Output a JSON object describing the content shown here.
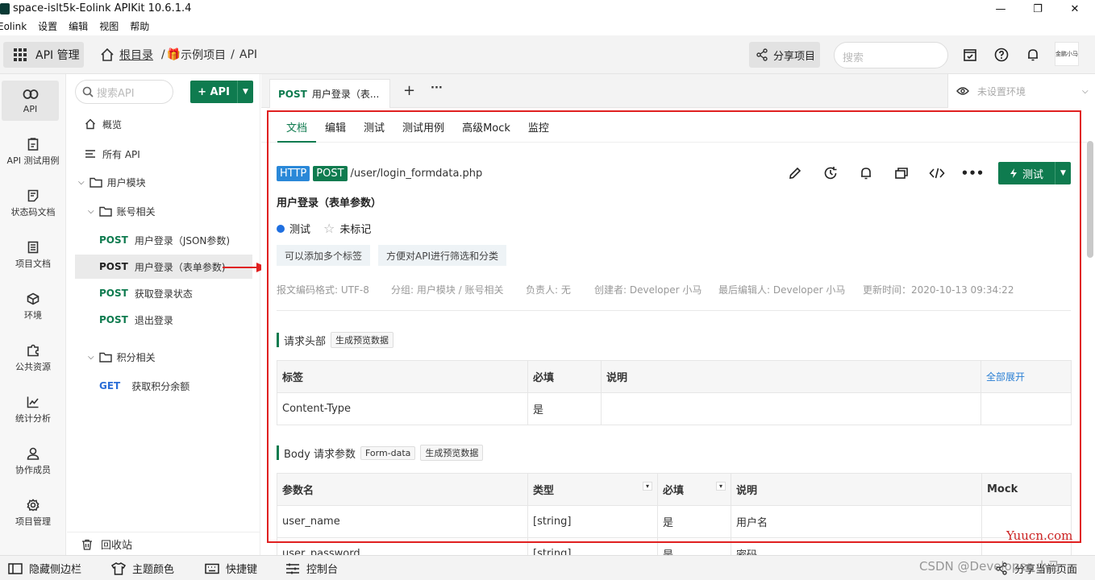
{
  "window": {
    "title": "space-islt5k-Eolink APIKit 10.6.1.4",
    "min": "—",
    "max": "❐",
    "close": "✕"
  },
  "menu": [
    "Eolink",
    "设置",
    "编辑",
    "视图",
    "帮助"
  ],
  "header": {
    "app_switch": "API 管理",
    "breadcrumb_root": "根目录",
    "breadcrumb_sep1": "/",
    "breadcrumb_project": "示例项目",
    "breadcrumb_sep2": "/",
    "breadcrumb_api": "API",
    "share_button": "分享项目",
    "search_placeholder": "搜索",
    "avatar_text": "金鹏小马"
  },
  "rail": [
    {
      "label": "API",
      "icon": "link-icon",
      "active": true
    },
    {
      "label": "API 测试用例",
      "icon": "clipboard-icon"
    },
    {
      "label": "状态码文档",
      "icon": "doc-icon"
    },
    {
      "label": "项目文档",
      "icon": "file-icon"
    },
    {
      "label": "环境",
      "icon": "cube-icon"
    },
    {
      "label": "公共资源",
      "icon": "puzzle-icon"
    },
    {
      "label": "统计分析",
      "icon": "chart-icon"
    },
    {
      "label": "协作成员",
      "icon": "user-icon"
    },
    {
      "label": "项目管理",
      "icon": "gear-icon"
    }
  ],
  "tree": {
    "search_placeholder": "搜索API",
    "add_button": "+ API",
    "overview": "概览",
    "all_api": "所有 API",
    "group_user": "用户模块",
    "group_account": "账号相关",
    "apis_account": [
      {
        "method": "POST",
        "name": "用户登录（JSON参数)"
      },
      {
        "method": "POST",
        "name": "用户登录（表单参数)"
      },
      {
        "method": "POST",
        "name": "获取登录状态"
      },
      {
        "method": "POST",
        "name": "退出登录"
      }
    ],
    "group_points": "积分相关",
    "apis_points": [
      {
        "method": "GET",
        "name": "获取积分余额"
      }
    ],
    "recycle": "回收站"
  },
  "tabs": {
    "active_method": "POST",
    "active_label": "用户登录（表...",
    "add": "+",
    "more": "···",
    "env": "未设置环境"
  },
  "doc": {
    "subtabs": [
      "文档",
      "编辑",
      "测试",
      "测试用例",
      "高级Mock",
      "监控"
    ],
    "protocol": "HTTP",
    "method": "POST",
    "path": "/user/login_formdata.php",
    "title": "用户登录（表单参数）",
    "status": "测试",
    "star_label": "未标记",
    "tags": [
      "可以添加多个标签",
      "方便对API进行筛选和分类"
    ],
    "test_button": "测试",
    "meta": [
      "报文编码格式: UTF-8",
      "分组: 用户模块 / 账号相关",
      "负责人: 无",
      "创建者: Developer 小马",
      "最后编辑人: Developer 小马",
      "更新时间：2020-10-13 09:34:22"
    ],
    "headers_section": {
      "title": "请求头部",
      "chip": "生成预览数据",
      "columns": [
        "标签",
        "必填",
        "说明"
      ],
      "expand": "全部展开",
      "rows": [
        {
          "name": "Content-Type",
          "required": "是",
          "desc": ""
        }
      ]
    },
    "body_section": {
      "title": "Body 请求参数",
      "chip1": "Form-data",
      "chip2": "生成预览数据",
      "columns": [
        "参数名",
        "类型",
        "必填",
        "说明",
        "Mock"
      ],
      "rows": [
        {
          "name": "user_name",
          "type": "[string]",
          "required": "是",
          "desc": "用户名",
          "mock": ""
        },
        {
          "name": "user_password",
          "type": "[string]",
          "required": "是",
          "desc": "密码",
          "mock": ""
        }
      ]
    }
  },
  "bottombar": {
    "hide_sidebar": "隐藏侧边栏",
    "theme": "主题颜色",
    "shortcuts": "快捷键",
    "console": "控制台",
    "share_page": "分享当前页面"
  },
  "watermarks": {
    "site": "Yuucn.com",
    "csdn": "CSDN @Developer 小马"
  }
}
